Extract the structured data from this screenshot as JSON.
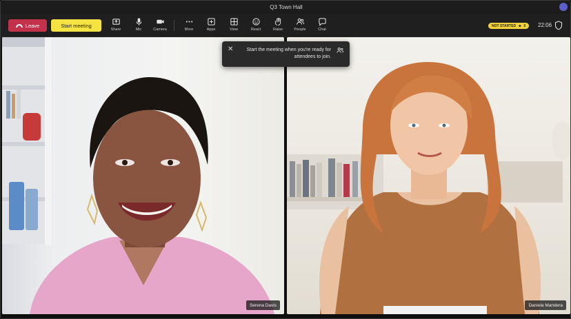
{
  "window": {
    "title": "Q3 Town Hall"
  },
  "toolbar": {
    "leave_label": "Leave",
    "start_label": "Start meeting",
    "tools": [
      {
        "key": "share",
        "label": "Share"
      },
      {
        "key": "mic",
        "label": "Mic"
      },
      {
        "key": "camera",
        "label": "Camera"
      },
      {
        "key": "more",
        "label": "More"
      },
      {
        "key": "apps",
        "label": "Apps"
      },
      {
        "key": "view",
        "label": "View"
      },
      {
        "key": "react",
        "label": "React"
      },
      {
        "key": "raise",
        "label": "Raise"
      },
      {
        "key": "people",
        "label": "People"
      },
      {
        "key": "chat",
        "label": "Chat"
      }
    ],
    "status_badge": "NOT STARTED",
    "attendee_count": "0",
    "timer": "22:06"
  },
  "popup": {
    "message": "Start the meeting when you're ready for attendees to join."
  },
  "participants": [
    {
      "name": "Serena Davis"
    },
    {
      "name": "Daniela Mandera"
    }
  ],
  "colors": {
    "leave": "#c4314b",
    "start": "#f5e243",
    "badge": "#f0d33c",
    "toolbar": "#1f1f1f"
  }
}
